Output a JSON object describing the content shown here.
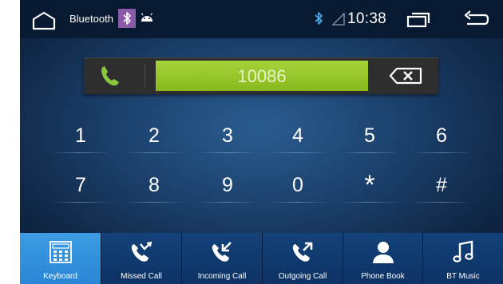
{
  "status_bar": {
    "title": "Bluetooth",
    "time": "10:38"
  },
  "dialer": {
    "number": "10086"
  },
  "keypad": {
    "keys": [
      "1",
      "2",
      "3",
      "4",
      "5",
      "6",
      "7",
      "8",
      "9",
      "0",
      "*",
      "#"
    ]
  },
  "bottom_nav": {
    "tabs": [
      {
        "label": "Keyboard",
        "active": true
      },
      {
        "label": "Missed Call",
        "active": false
      },
      {
        "label": "Incoming Call",
        "active": false
      },
      {
        "label": "Outgoing Call",
        "active": false
      },
      {
        "label": "Phone Book",
        "active": false
      },
      {
        "label": "BT Music",
        "active": false
      }
    ]
  },
  "colors": {
    "accent_green": "#a6d23a",
    "active_tab": "#3d9ce3",
    "status_bar_bg": "#071a31",
    "bt_badge": "#8b5aa6"
  },
  "icons": [
    "home-icon",
    "bluetooth-icon",
    "android-icon",
    "signal-icon",
    "recent-apps-icon",
    "back-icon",
    "phone-icon",
    "backspace-icon",
    "keypad-icon",
    "missed-call-icon",
    "incoming-call-icon",
    "outgoing-call-icon",
    "contact-icon",
    "music-note-icon"
  ]
}
